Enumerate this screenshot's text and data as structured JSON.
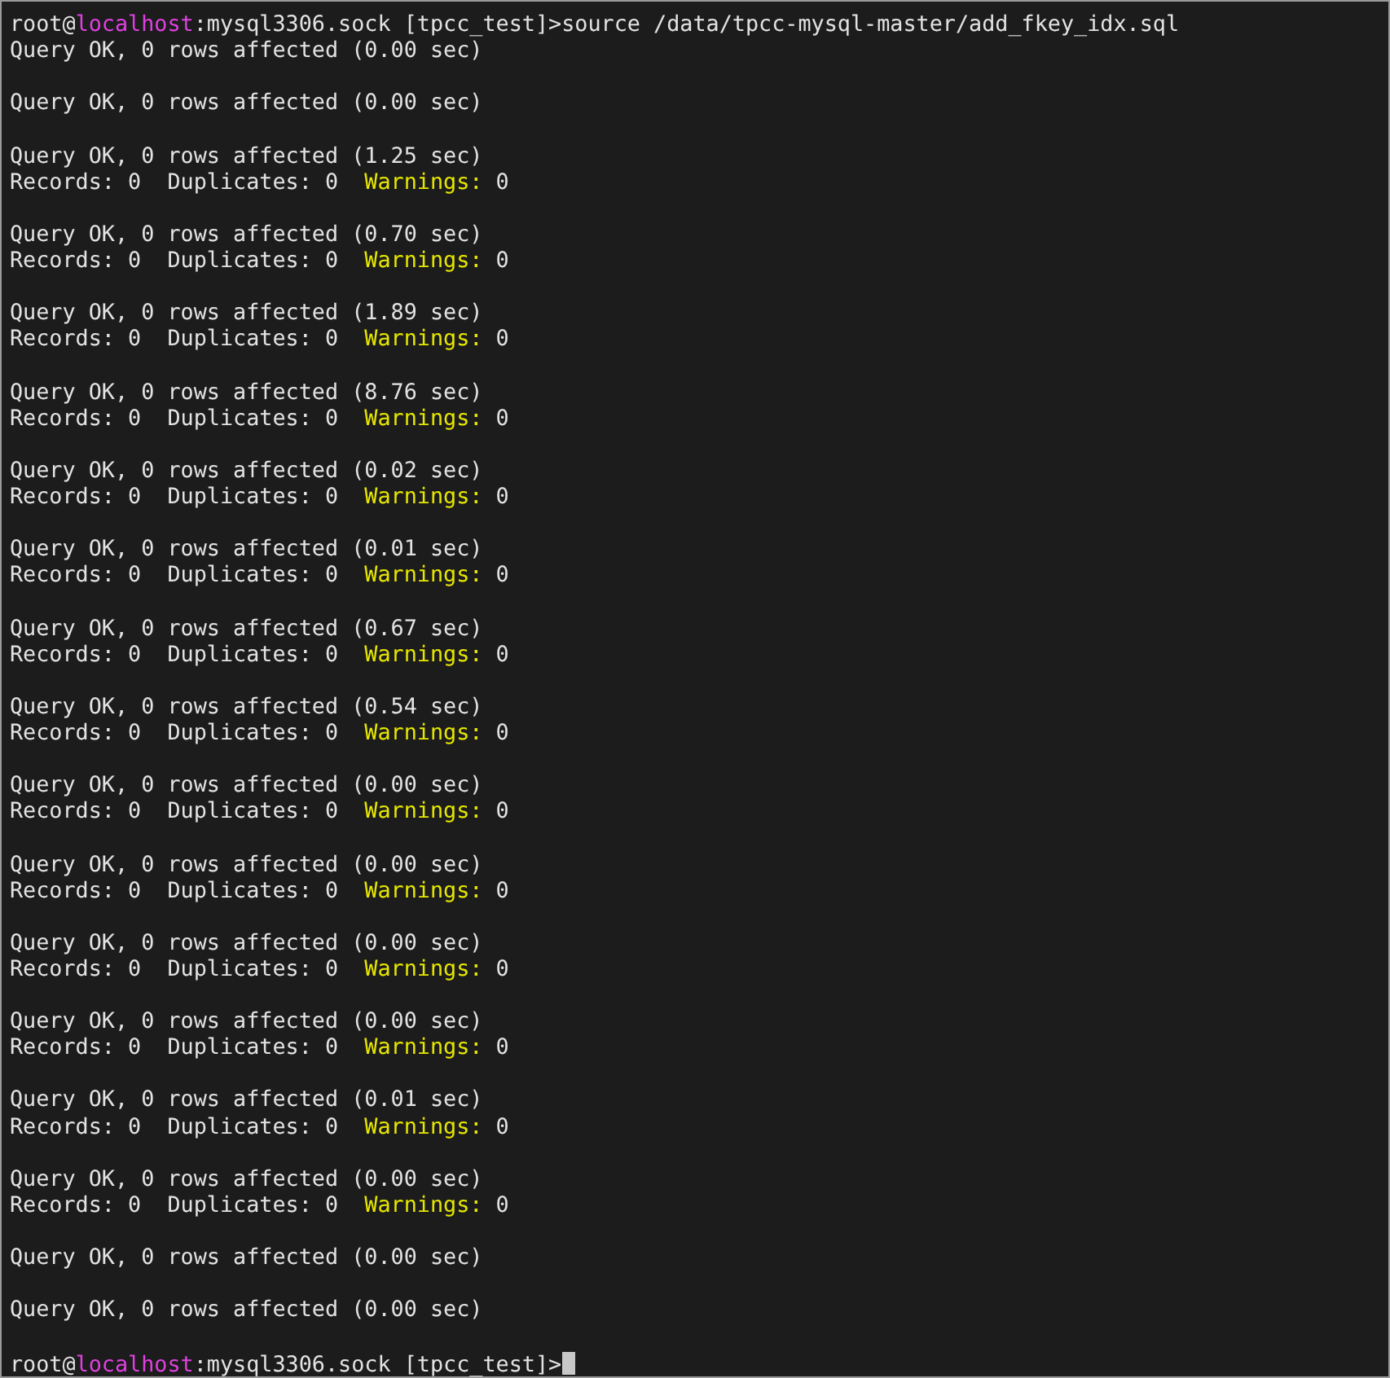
{
  "terminal": {
    "lines": [
      {
        "kind": "prompt",
        "user": "root@",
        "host": "localhost",
        "path": ":mysql3306.sock [tpcc_test]>",
        "command": "source /data/tpcc-mysql-master/add_fkey_idx.sql",
        "cursor": false
      },
      {
        "kind": "query",
        "text": "Query OK, 0 rows affected (0.00 sec)"
      },
      {
        "kind": "blank"
      },
      {
        "kind": "query",
        "text": "Query OK, 0 rows affected (0.00 sec)"
      },
      {
        "kind": "blank"
      },
      {
        "kind": "query",
        "text": "Query OK, 0 rows affected (1.25 sec)"
      },
      {
        "kind": "records",
        "text": "Records: 0  Duplicates: 0  ",
        "warn_label": "Warnings:",
        "warn_value": " 0"
      },
      {
        "kind": "blank"
      },
      {
        "kind": "query",
        "text": "Query OK, 0 rows affected (0.70 sec)"
      },
      {
        "kind": "records",
        "text": "Records: 0  Duplicates: 0  ",
        "warn_label": "Warnings:",
        "warn_value": " 0"
      },
      {
        "kind": "blank"
      },
      {
        "kind": "query",
        "text": "Query OK, 0 rows affected (1.89 sec)"
      },
      {
        "kind": "records",
        "text": "Records: 0  Duplicates: 0  ",
        "warn_label": "Warnings:",
        "warn_value": " 0"
      },
      {
        "kind": "blank"
      },
      {
        "kind": "query",
        "text": "Query OK, 0 rows affected (8.76 sec)"
      },
      {
        "kind": "records",
        "text": "Records: 0  Duplicates: 0  ",
        "warn_label": "Warnings:",
        "warn_value": " 0"
      },
      {
        "kind": "blank"
      },
      {
        "kind": "query",
        "text": "Query OK, 0 rows affected (0.02 sec)"
      },
      {
        "kind": "records",
        "text": "Records: 0  Duplicates: 0  ",
        "warn_label": "Warnings:",
        "warn_value": " 0"
      },
      {
        "kind": "blank"
      },
      {
        "kind": "query",
        "text": "Query OK, 0 rows affected (0.01 sec)"
      },
      {
        "kind": "records",
        "text": "Records: 0  Duplicates: 0  ",
        "warn_label": "Warnings:",
        "warn_value": " 0"
      },
      {
        "kind": "blank"
      },
      {
        "kind": "query",
        "text": "Query OK, 0 rows affected (0.67 sec)"
      },
      {
        "kind": "records",
        "text": "Records: 0  Duplicates: 0  ",
        "warn_label": "Warnings:",
        "warn_value": " 0"
      },
      {
        "kind": "blank"
      },
      {
        "kind": "query",
        "text": "Query OK, 0 rows affected (0.54 sec)"
      },
      {
        "kind": "records",
        "text": "Records: 0  Duplicates: 0  ",
        "warn_label": "Warnings:",
        "warn_value": " 0"
      },
      {
        "kind": "blank"
      },
      {
        "kind": "query",
        "text": "Query OK, 0 rows affected (0.00 sec)"
      },
      {
        "kind": "records",
        "text": "Records: 0  Duplicates: 0  ",
        "warn_label": "Warnings:",
        "warn_value": " 0"
      },
      {
        "kind": "blank"
      },
      {
        "kind": "query",
        "text": "Query OK, 0 rows affected (0.00 sec)"
      },
      {
        "kind": "records",
        "text": "Records: 0  Duplicates: 0  ",
        "warn_label": "Warnings:",
        "warn_value": " 0"
      },
      {
        "kind": "blank"
      },
      {
        "kind": "query",
        "text": "Query OK, 0 rows affected (0.00 sec)"
      },
      {
        "kind": "records",
        "text": "Records: 0  Duplicates: 0  ",
        "warn_label": "Warnings:",
        "warn_value": " 0"
      },
      {
        "kind": "blank"
      },
      {
        "kind": "query",
        "text": "Query OK, 0 rows affected (0.00 sec)"
      },
      {
        "kind": "records",
        "text": "Records: 0  Duplicates: 0  ",
        "warn_label": "Warnings:",
        "warn_value": " 0"
      },
      {
        "kind": "blank"
      },
      {
        "kind": "query",
        "text": "Query OK, 0 rows affected (0.01 sec)"
      },
      {
        "kind": "records",
        "text": "Records: 0  Duplicates: 0  ",
        "warn_label": "Warnings:",
        "warn_value": " 0"
      },
      {
        "kind": "blank"
      },
      {
        "kind": "query",
        "text": "Query OK, 0 rows affected (0.00 sec)"
      },
      {
        "kind": "records",
        "text": "Records: 0  Duplicates: 0  ",
        "warn_label": "Warnings:",
        "warn_value": " 0"
      },
      {
        "kind": "blank"
      },
      {
        "kind": "query",
        "text": "Query OK, 0 rows affected (0.00 sec)"
      },
      {
        "kind": "blank"
      },
      {
        "kind": "query",
        "text": "Query OK, 0 rows affected (0.00 sec)"
      },
      {
        "kind": "blank"
      },
      {
        "kind": "prompt",
        "user": "root@",
        "host": "localhost",
        "path": ":mysql3306.sock [tpcc_test]>",
        "cursor": true
      }
    ]
  }
}
